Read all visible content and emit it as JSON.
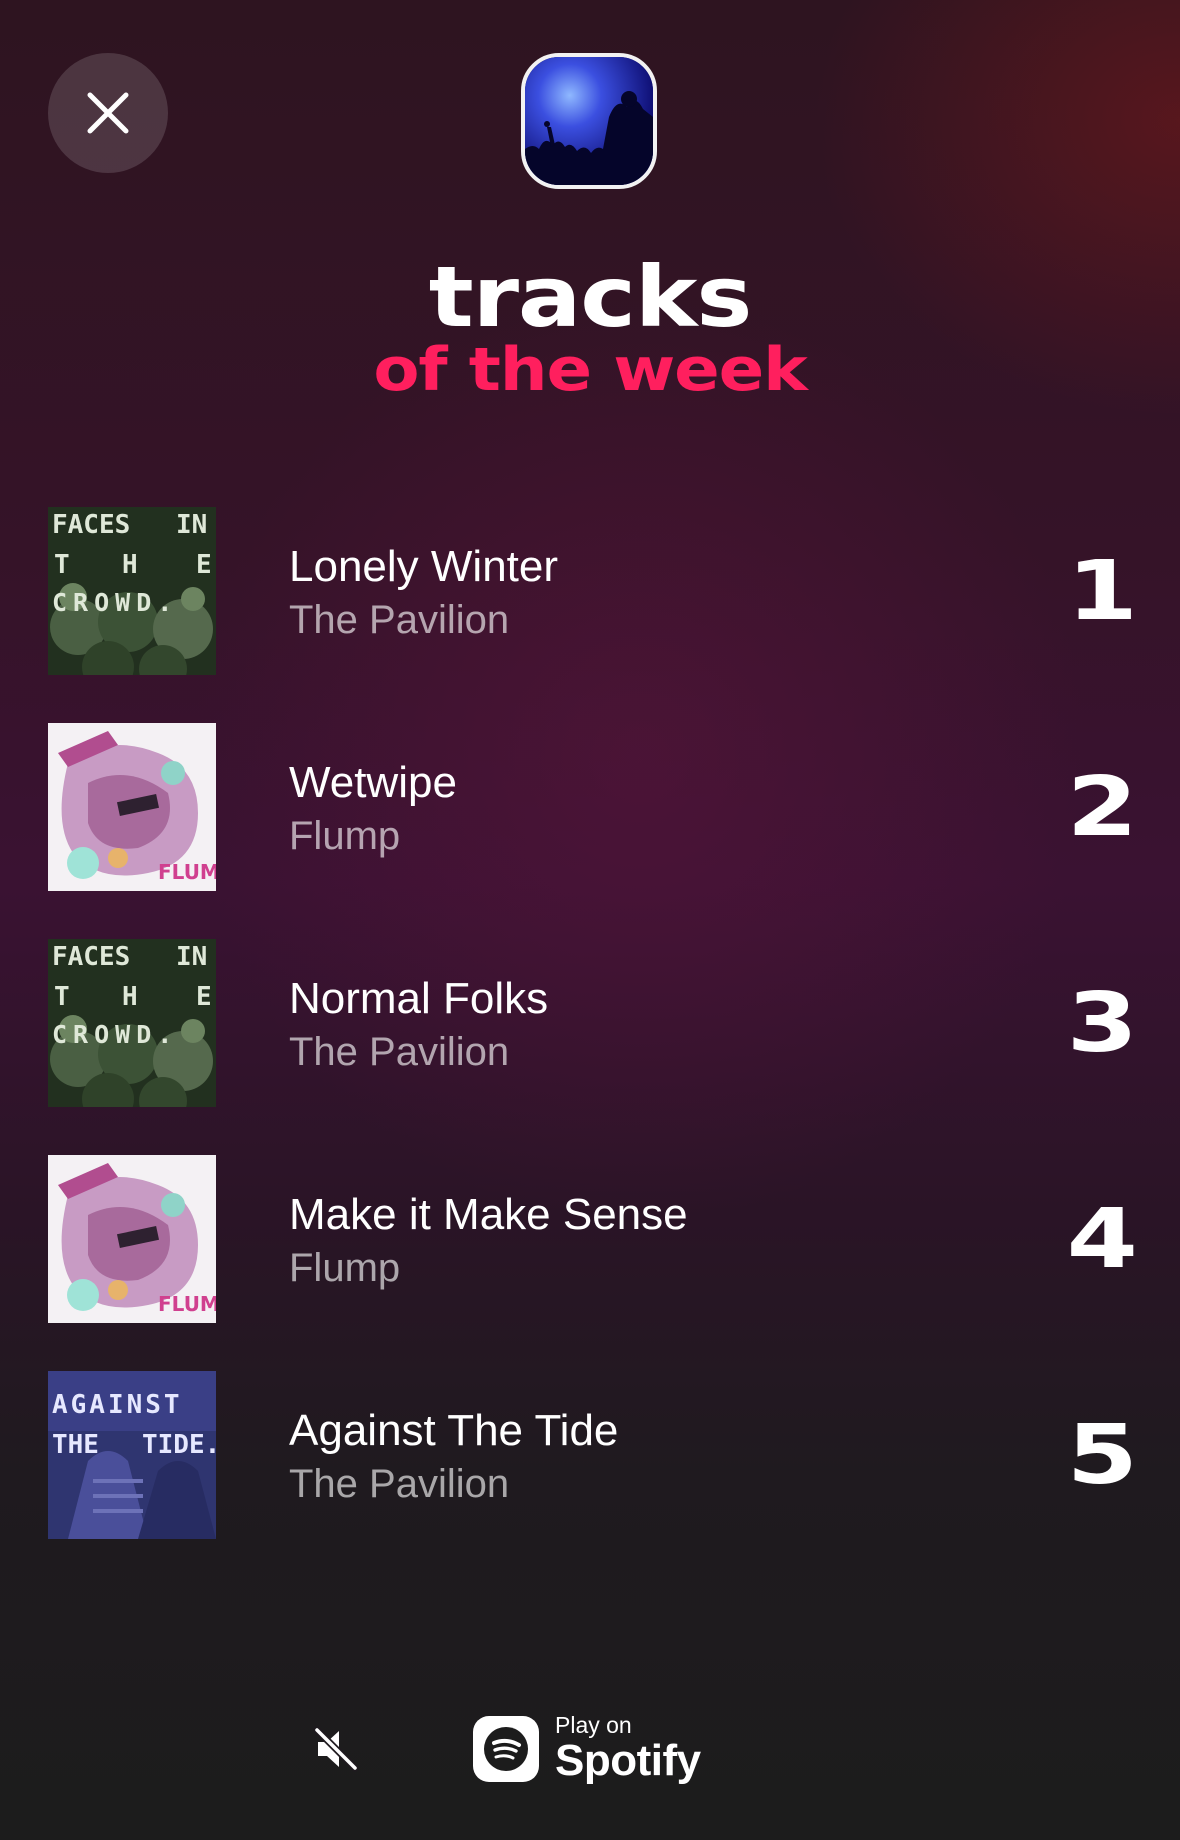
{
  "header": {
    "close_icon": "close-icon",
    "cover_image": "concert-crowd-image"
  },
  "title": {
    "main": "tracks",
    "sub": "of the week",
    "main_color": "#ffffff",
    "sub_color": "#ff1f5e"
  },
  "tracks": [
    {
      "rank": "1",
      "name": "Lonely Winter",
      "artist": "The Pavilion",
      "art": "faces-in-the-crowd",
      "art_text": [
        "FACES",
        "IN",
        "T",
        "H",
        "E",
        "CROWD."
      ]
    },
    {
      "rank": "2",
      "name": "Wetwipe",
      "artist": "Flump",
      "art": "flump-illustration",
      "art_text": [
        "FLUMP!"
      ]
    },
    {
      "rank": "3",
      "name": "Normal Folks",
      "artist": "The Pavilion",
      "art": "faces-in-the-crowd",
      "art_text": [
        "FACES",
        "IN",
        "T",
        "H",
        "E",
        "CROWD."
      ]
    },
    {
      "rank": "4",
      "name": "Make it Make Sense",
      "artist": "Flump",
      "art": "flump-illustration",
      "art_text": [
        "FLUMP!"
      ]
    },
    {
      "rank": "5",
      "name": "Against The Tide",
      "artist": "The Pavilion",
      "art": "against-the-tide",
      "art_text": [
        "AGAINST",
        "THE",
        "TIDE."
      ]
    }
  ],
  "footer": {
    "mute_icon": "speaker-muted-icon",
    "spotify": {
      "play_label": "Play on",
      "brand_label": "Spotify",
      "icon": "spotify-icon"
    }
  }
}
